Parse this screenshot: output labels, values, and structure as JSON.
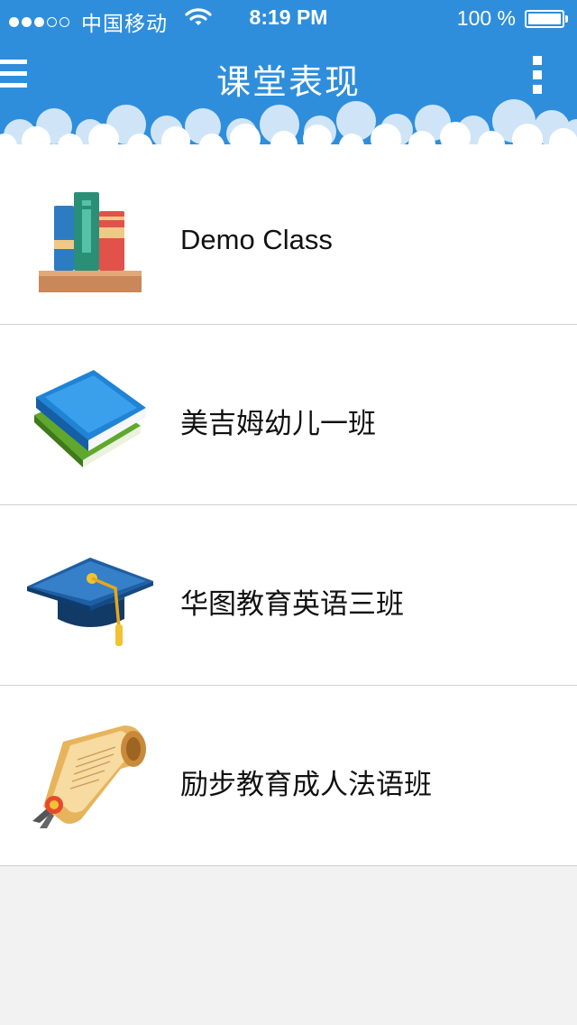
{
  "statusbar": {
    "carrier": "中国移动",
    "time": "8:19 PM",
    "battery": "100 %",
    "signal_bars_filled": 3,
    "signal_bars_total": 5
  },
  "header": {
    "title": "课堂表现",
    "menu_icon": "hamburger-menu-icon",
    "more_icon": "vertical-more-icon",
    "background_color": "#2f8edb"
  },
  "classes": [
    {
      "name": "Demo Class",
      "icon": "bookshelf-icon"
    },
    {
      "name": "美吉姆幼儿一班",
      "icon": "stacked-books-icon"
    },
    {
      "name": "华图教育英语三班",
      "icon": "graduation-cap-icon"
    },
    {
      "name": "励步教育成人法语班",
      "icon": "diploma-scroll-icon"
    }
  ]
}
